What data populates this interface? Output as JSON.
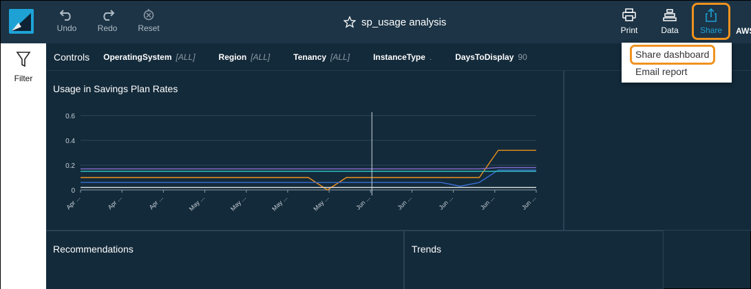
{
  "toolbar": {
    "undo_label": "Undo",
    "redo_label": "Redo",
    "reset_label": "Reset",
    "title": "sp_usage analysis",
    "print_label": "Print",
    "data_label": "Data",
    "share_label": "Share",
    "account_label_truncated": "AWS"
  },
  "sidebar": {
    "filter_label": "Filter"
  },
  "controls": {
    "title": "Controls",
    "items": [
      {
        "name": "OperatingSystem",
        "value": "[ALL]"
      },
      {
        "name": "Region",
        "value": "[ALL]"
      },
      {
        "name": "Tenancy",
        "value": "[ALL]"
      },
      {
        "name": "InstanceType",
        "value": "."
      },
      {
        "name": "DaysToDisplay",
        "value": "90"
      }
    ]
  },
  "share_menu": {
    "items": [
      "Share dashboard",
      "Email report"
    ]
  },
  "panels": {
    "usage_title": "Usage in Savings Plan Rates",
    "recommendations_title": "Recommendations",
    "trends_title": "Trends"
  },
  "colors": {
    "topbar": "#1c3446",
    "background": "#132a3a",
    "accent_share": "#1ea2d6",
    "highlight": "#f0921e"
  },
  "chart_data": {
    "type": "line",
    "title": "Usage in Savings Plan Rates",
    "ylim": [
      0,
      0.6
    ],
    "yticks": [
      "0",
      "0.2",
      "0.4",
      "0.6"
    ],
    "x_tick_labels": [
      "Apr ...",
      "Apr ...",
      "Apr ...",
      "May ...",
      "May ...",
      "May ...",
      "May ...",
      "Jun ...",
      "Jun ...",
      "Jun ...",
      "Jun ...",
      "Jun ..."
    ],
    "x_points": 25,
    "grid": true,
    "cursor_at_tick": 7,
    "series": [
      {
        "color": "#f0921e",
        "values": [
          0.1,
          0.1,
          0.1,
          0.1,
          0.1,
          0.1,
          0.1,
          0.1,
          0.1,
          0.1,
          0.1,
          0.1,
          0.1,
          0.0,
          0.1,
          0.1,
          0.1,
          0.1,
          0.1,
          0.1,
          0.1,
          0.1,
          0.32,
          0.32,
          0.32
        ]
      },
      {
        "color": "#8a6fd1",
        "values": [
          0.17,
          0.17,
          0.17,
          0.17,
          0.17,
          0.17,
          0.17,
          0.17,
          0.17,
          0.17,
          0.17,
          0.17,
          0.17,
          0.17,
          0.17,
          0.17,
          0.17,
          0.17,
          0.17,
          0.17,
          0.17,
          0.17,
          0.18,
          0.18,
          0.18
        ]
      },
      {
        "color": "#3b6fd4",
        "values": [
          0.06,
          0.06,
          0.06,
          0.06,
          0.06,
          0.06,
          0.06,
          0.06,
          0.06,
          0.06,
          0.06,
          0.06,
          0.06,
          0.06,
          0.06,
          0.06,
          0.06,
          0.06,
          0.06,
          0.06,
          0.03,
          0.06,
          0.16,
          0.16,
          0.16
        ]
      },
      {
        "color": "#2fbfbf",
        "values": [
          0.15,
          0.15,
          0.15,
          0.15,
          0.15,
          0.15,
          0.15,
          0.15,
          0.15,
          0.15,
          0.15,
          0.15,
          0.15,
          0.15,
          0.15,
          0.15,
          0.15,
          0.15,
          0.15,
          0.15,
          0.15,
          0.15,
          0.15,
          0.15,
          0.15
        ]
      },
      {
        "color": "#e6e6e6",
        "values": [
          0.02,
          0.02,
          0.02,
          0.02,
          0.02,
          0.02,
          0.02,
          0.02,
          0.02,
          0.02,
          0.02,
          0.02,
          0.02,
          0.02,
          0.02,
          0.02,
          0.02,
          0.02,
          0.02,
          0.02,
          0.02,
          0.02,
          0.02,
          0.02,
          0.02
        ]
      }
    ]
  }
}
